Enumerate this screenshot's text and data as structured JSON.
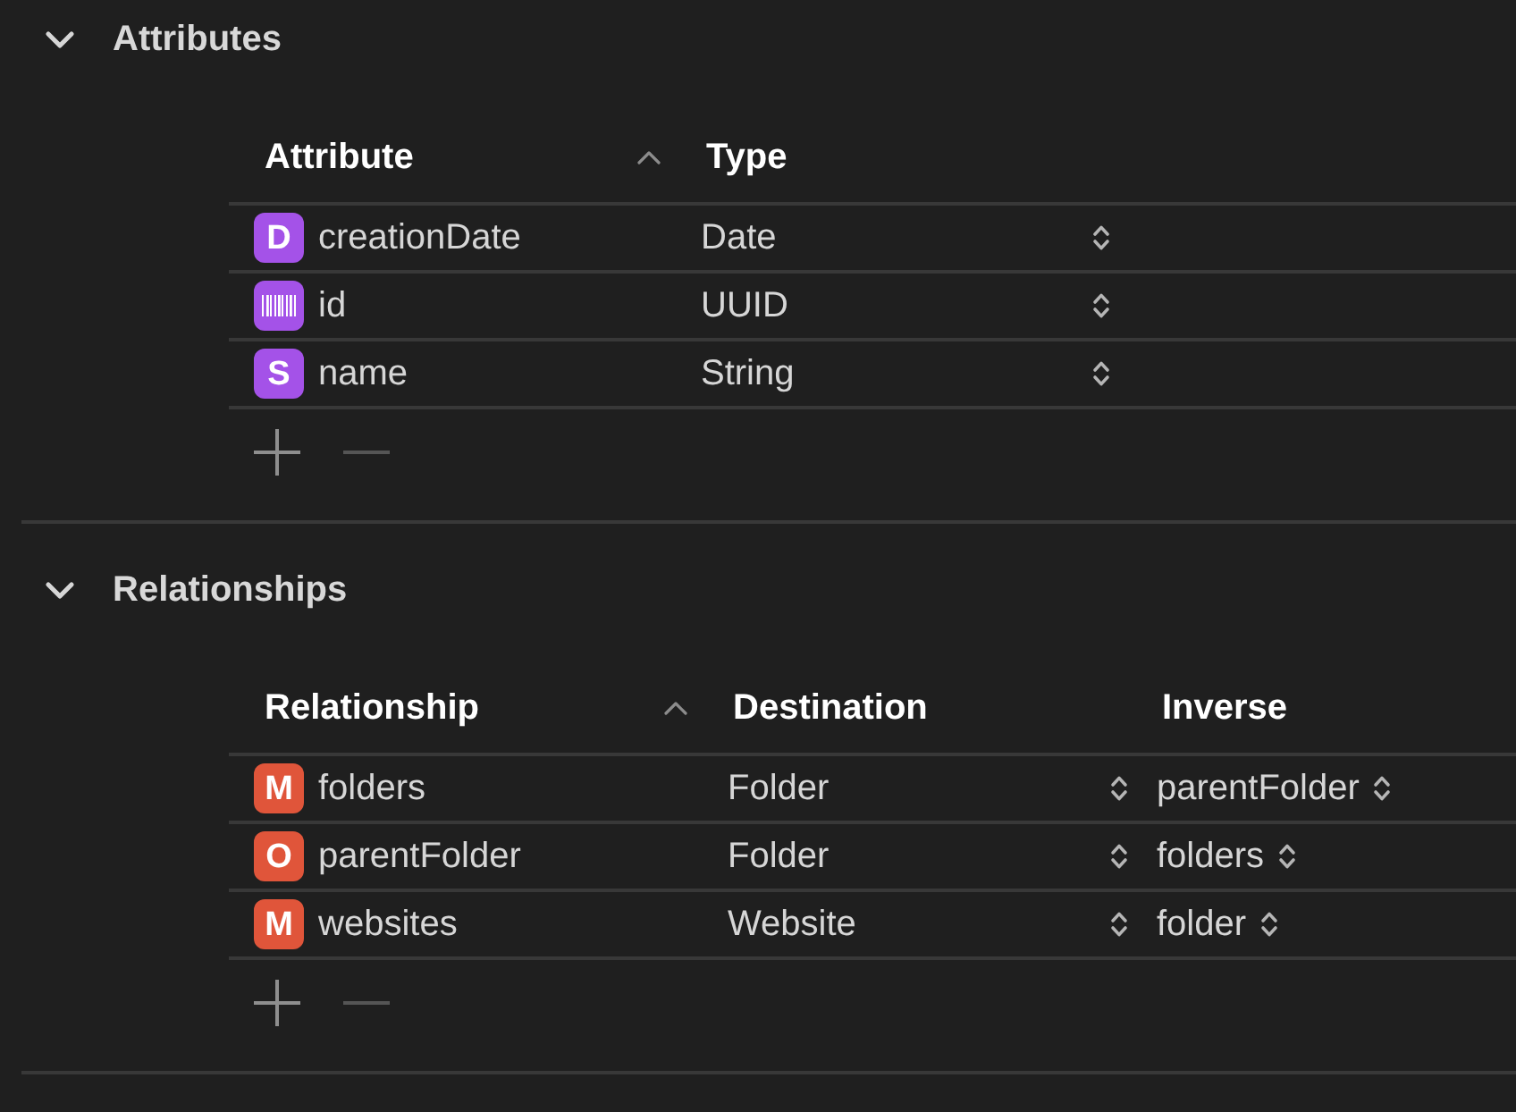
{
  "sections": [
    {
      "kind": "attributes",
      "title": "Attributes",
      "expanded": true,
      "columns": [
        {
          "label": "Attribute",
          "sorted": true
        },
        {
          "label": "Type",
          "sorted": false
        }
      ],
      "rows": [
        {
          "badge": {
            "kind": "letter",
            "letter": "D",
            "color": "#a452e8"
          },
          "name": "creationDate",
          "values": [
            "Date"
          ]
        },
        {
          "badge": {
            "kind": "barcode",
            "color": "#a452e8"
          },
          "name": "id",
          "values": [
            "UUID"
          ]
        },
        {
          "badge": {
            "kind": "letter",
            "letter": "S",
            "color": "#a452e8"
          },
          "name": "name",
          "values": [
            "String"
          ]
        }
      ],
      "buttons": [
        {
          "kind": "add",
          "disabled": false
        },
        {
          "kind": "remove",
          "disabled": true
        }
      ]
    },
    {
      "kind": "relationships",
      "title": "Relationships",
      "expanded": true,
      "columns": [
        {
          "label": "Relationship",
          "sorted": true
        },
        {
          "label": "Destination",
          "sorted": false
        },
        {
          "label": "Inverse",
          "sorted": false
        }
      ],
      "rows": [
        {
          "badge": {
            "kind": "letter",
            "letter": "M",
            "color": "#e0553a"
          },
          "name": "folders",
          "values": [
            "Folder",
            "parentFolder"
          ]
        },
        {
          "badge": {
            "kind": "letter",
            "letter": "O",
            "color": "#e0553a"
          },
          "name": "parentFolder",
          "values": [
            "Folder",
            "folders"
          ]
        },
        {
          "badge": {
            "kind": "letter",
            "letter": "M",
            "color": "#e0553a"
          },
          "name": "websites",
          "values": [
            "Website",
            "folder"
          ]
        }
      ],
      "buttons": [
        {
          "kind": "add",
          "disabled": false
        },
        {
          "kind": "remove",
          "disabled": true
        }
      ]
    }
  ]
}
